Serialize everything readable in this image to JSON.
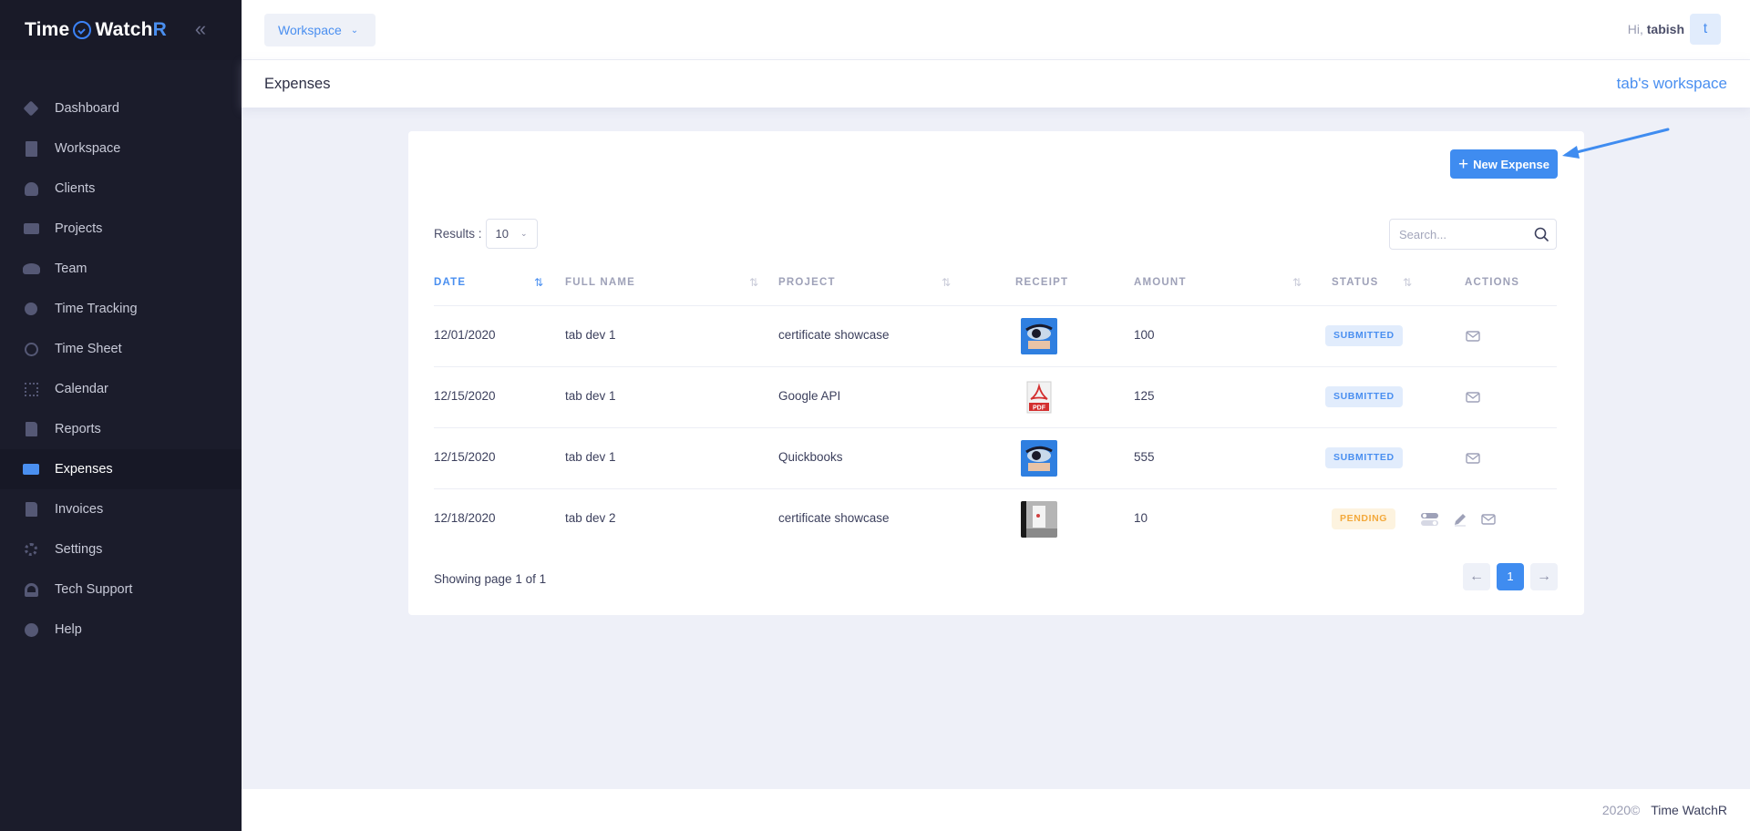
{
  "brand": {
    "name_part1": "Time",
    "name_part2": "Watch",
    "name_part3": "R"
  },
  "sidebar": {
    "collapse_icon": "double-chevron-left-icon",
    "items": [
      {
        "label": "Dashboard",
        "icon": "diamond-icon"
      },
      {
        "label": "Workspace",
        "icon": "building-icon"
      },
      {
        "label": "Clients",
        "icon": "user-icon"
      },
      {
        "label": "Projects",
        "icon": "monitor-icon"
      },
      {
        "label": "Team",
        "icon": "team-icon"
      },
      {
        "label": "Time Tracking",
        "icon": "stopwatch-icon"
      },
      {
        "label": "Time Sheet",
        "icon": "clock-icon"
      },
      {
        "label": "Calendar",
        "icon": "calendar-icon"
      },
      {
        "label": "Reports",
        "icon": "report-icon"
      },
      {
        "label": "Expenses",
        "icon": "money-icon",
        "active": true
      },
      {
        "label": "Invoices",
        "icon": "invoice-icon"
      },
      {
        "label": "Settings",
        "icon": "gear-icon"
      },
      {
        "label": "Tech Support",
        "icon": "headset-icon"
      },
      {
        "label": "Help",
        "icon": "help-icon"
      }
    ]
  },
  "header": {
    "workspace_select": "Workspace",
    "greeting_prefix": "Hi,",
    "user_name": "tabish",
    "avatar_letter": "t"
  },
  "subheader": {
    "page_title": "Expenses",
    "workspace_name": "tab's workspace"
  },
  "toolbar": {
    "new_expense_label": "New Expense"
  },
  "results": {
    "label": "Results :",
    "value": "10"
  },
  "search": {
    "placeholder": "Search..."
  },
  "table": {
    "columns": [
      {
        "key": "date",
        "label": "DATE",
        "sort_active": true
      },
      {
        "key": "full_name",
        "label": "FULL NAME"
      },
      {
        "key": "project",
        "label": "PROJECT"
      },
      {
        "key": "receipt",
        "label": "RECEIPT"
      },
      {
        "key": "amount",
        "label": "AMOUNT"
      },
      {
        "key": "status",
        "label": "STATUS"
      },
      {
        "key": "actions",
        "label": "ACTIONS"
      }
    ],
    "rows": [
      {
        "date": "12/01/2020",
        "full_name": "tab dev 1",
        "project": "certificate showcase",
        "receipt": "image-thumbnail",
        "amount": "100",
        "status": "SUBMITTED",
        "actions": [
          "mail-icon"
        ]
      },
      {
        "date": "12/15/2020",
        "full_name": "tab dev 1",
        "project": "Google API",
        "receipt": "pdf-file-icon",
        "amount": "125",
        "status": "SUBMITTED",
        "actions": [
          "mail-icon"
        ]
      },
      {
        "date": "12/15/2020",
        "full_name": "tab dev 1",
        "project": "Quickbooks",
        "receipt": "image-thumbnail",
        "amount": "555",
        "status": "SUBMITTED",
        "actions": [
          "mail-icon"
        ]
      },
      {
        "date": "12/18/2020",
        "full_name": "tab dev 2",
        "project": "certificate showcase",
        "receipt": "image-thumbnail",
        "amount": "10",
        "status": "PENDING",
        "actions": [
          "toggle-icon",
          "pencil-icon",
          "mail-icon"
        ]
      }
    ]
  },
  "pagination": {
    "showing": "Showing page 1 of 1",
    "current_page": "1",
    "prev_icon": "arrow-left-icon",
    "next_icon": "arrow-right-icon"
  },
  "footer": {
    "year": "2020©",
    "brand": "Time WatchR"
  },
  "colors": {
    "accent": "#3f8cf0",
    "sidebar_bg": "#1b1c2b",
    "pending": "#f3a93c",
    "page_bg": "#eef0f8"
  }
}
